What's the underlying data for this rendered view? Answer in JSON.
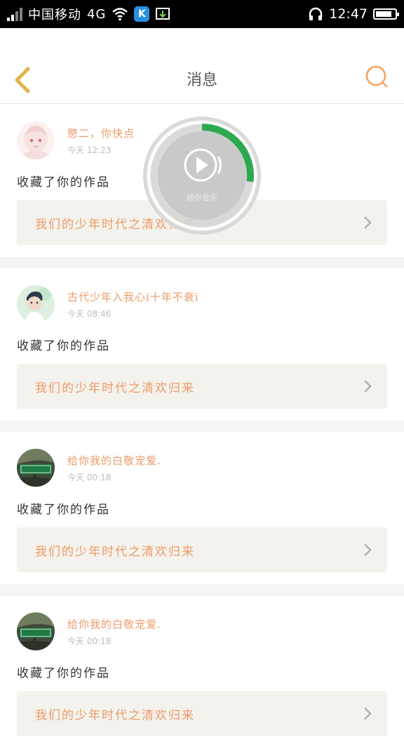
{
  "status_bar": {
    "carrier": "中国移动",
    "network": "4G",
    "time": "12:47"
  },
  "header": {
    "title": "消息"
  },
  "player": {
    "label": "顽你音乐",
    "progress": 0.27
  },
  "colors": {
    "accent": "#ec9b6a",
    "back_icon": "#e3b24a",
    "search_icon": "#f2a160",
    "player_progress": "#2ea84f"
  },
  "messages": [
    {
      "name": "愍二，你快点",
      "time": "今天  12:23",
      "action": "收藏了你的作品",
      "work_title": "我们的少年时代之清欢归来",
      "avatar": "anime-girl"
    },
    {
      "name": "古代少年入我心i十年不衰i",
      "time": "今天  08:46",
      "action": "收藏了你的作品",
      "work_title": "我们的少年时代之清欢归来",
      "avatar": "boy"
    },
    {
      "name": "给你我的白敬宠爱.",
      "time": "今天  00:18",
      "action": "收藏了你的作品",
      "work_title": "我们的少年时代之清欢归来",
      "avatar": "street-sign"
    },
    {
      "name": "给你我的白敬宠爱.",
      "time": "今天  00:18",
      "action": "收藏了你的作品",
      "work_title": "我们的少年时代之清欢归来",
      "avatar": "street-sign"
    }
  ]
}
